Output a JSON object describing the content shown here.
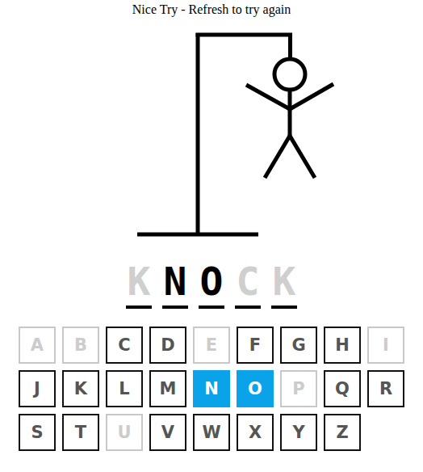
{
  "message": "Nice Try - Refresh to try again",
  "hangman": {
    "parts_shown": 6
  },
  "word": [
    {
      "letter": "K",
      "guessed": false
    },
    {
      "letter": "N",
      "guessed": true
    },
    {
      "letter": "O",
      "guessed": true
    },
    {
      "letter": "C",
      "guessed": false
    },
    {
      "letter": "K",
      "guessed": false
    }
  ],
  "keys": [
    {
      "label": "A",
      "disabled": true,
      "selected": false
    },
    {
      "label": "B",
      "disabled": true,
      "selected": false
    },
    {
      "label": "C",
      "disabled": false,
      "selected": false
    },
    {
      "label": "D",
      "disabled": false,
      "selected": false
    },
    {
      "label": "E",
      "disabled": true,
      "selected": false
    },
    {
      "label": "F",
      "disabled": false,
      "selected": false
    },
    {
      "label": "G",
      "disabled": false,
      "selected": false
    },
    {
      "label": "H",
      "disabled": false,
      "selected": false
    },
    {
      "label": "I",
      "disabled": true,
      "selected": false
    },
    {
      "label": "J",
      "disabled": false,
      "selected": false
    },
    {
      "label": "K",
      "disabled": false,
      "selected": false
    },
    {
      "label": "L",
      "disabled": false,
      "selected": false
    },
    {
      "label": "M",
      "disabled": false,
      "selected": false
    },
    {
      "label": "N",
      "disabled": false,
      "selected": true
    },
    {
      "label": "O",
      "disabled": false,
      "selected": true
    },
    {
      "label": "P",
      "disabled": true,
      "selected": false
    },
    {
      "label": "Q",
      "disabled": false,
      "selected": false
    },
    {
      "label": "R",
      "disabled": false,
      "selected": false
    },
    {
      "label": "S",
      "disabled": false,
      "selected": false
    },
    {
      "label": "T",
      "disabled": false,
      "selected": false
    },
    {
      "label": "U",
      "disabled": true,
      "selected": false
    },
    {
      "label": "V",
      "disabled": false,
      "selected": false
    },
    {
      "label": "W",
      "disabled": false,
      "selected": false
    },
    {
      "label": "X",
      "disabled": false,
      "selected": false
    },
    {
      "label": "Y",
      "disabled": false,
      "selected": false
    },
    {
      "label": "Z",
      "disabled": false,
      "selected": false
    }
  ]
}
